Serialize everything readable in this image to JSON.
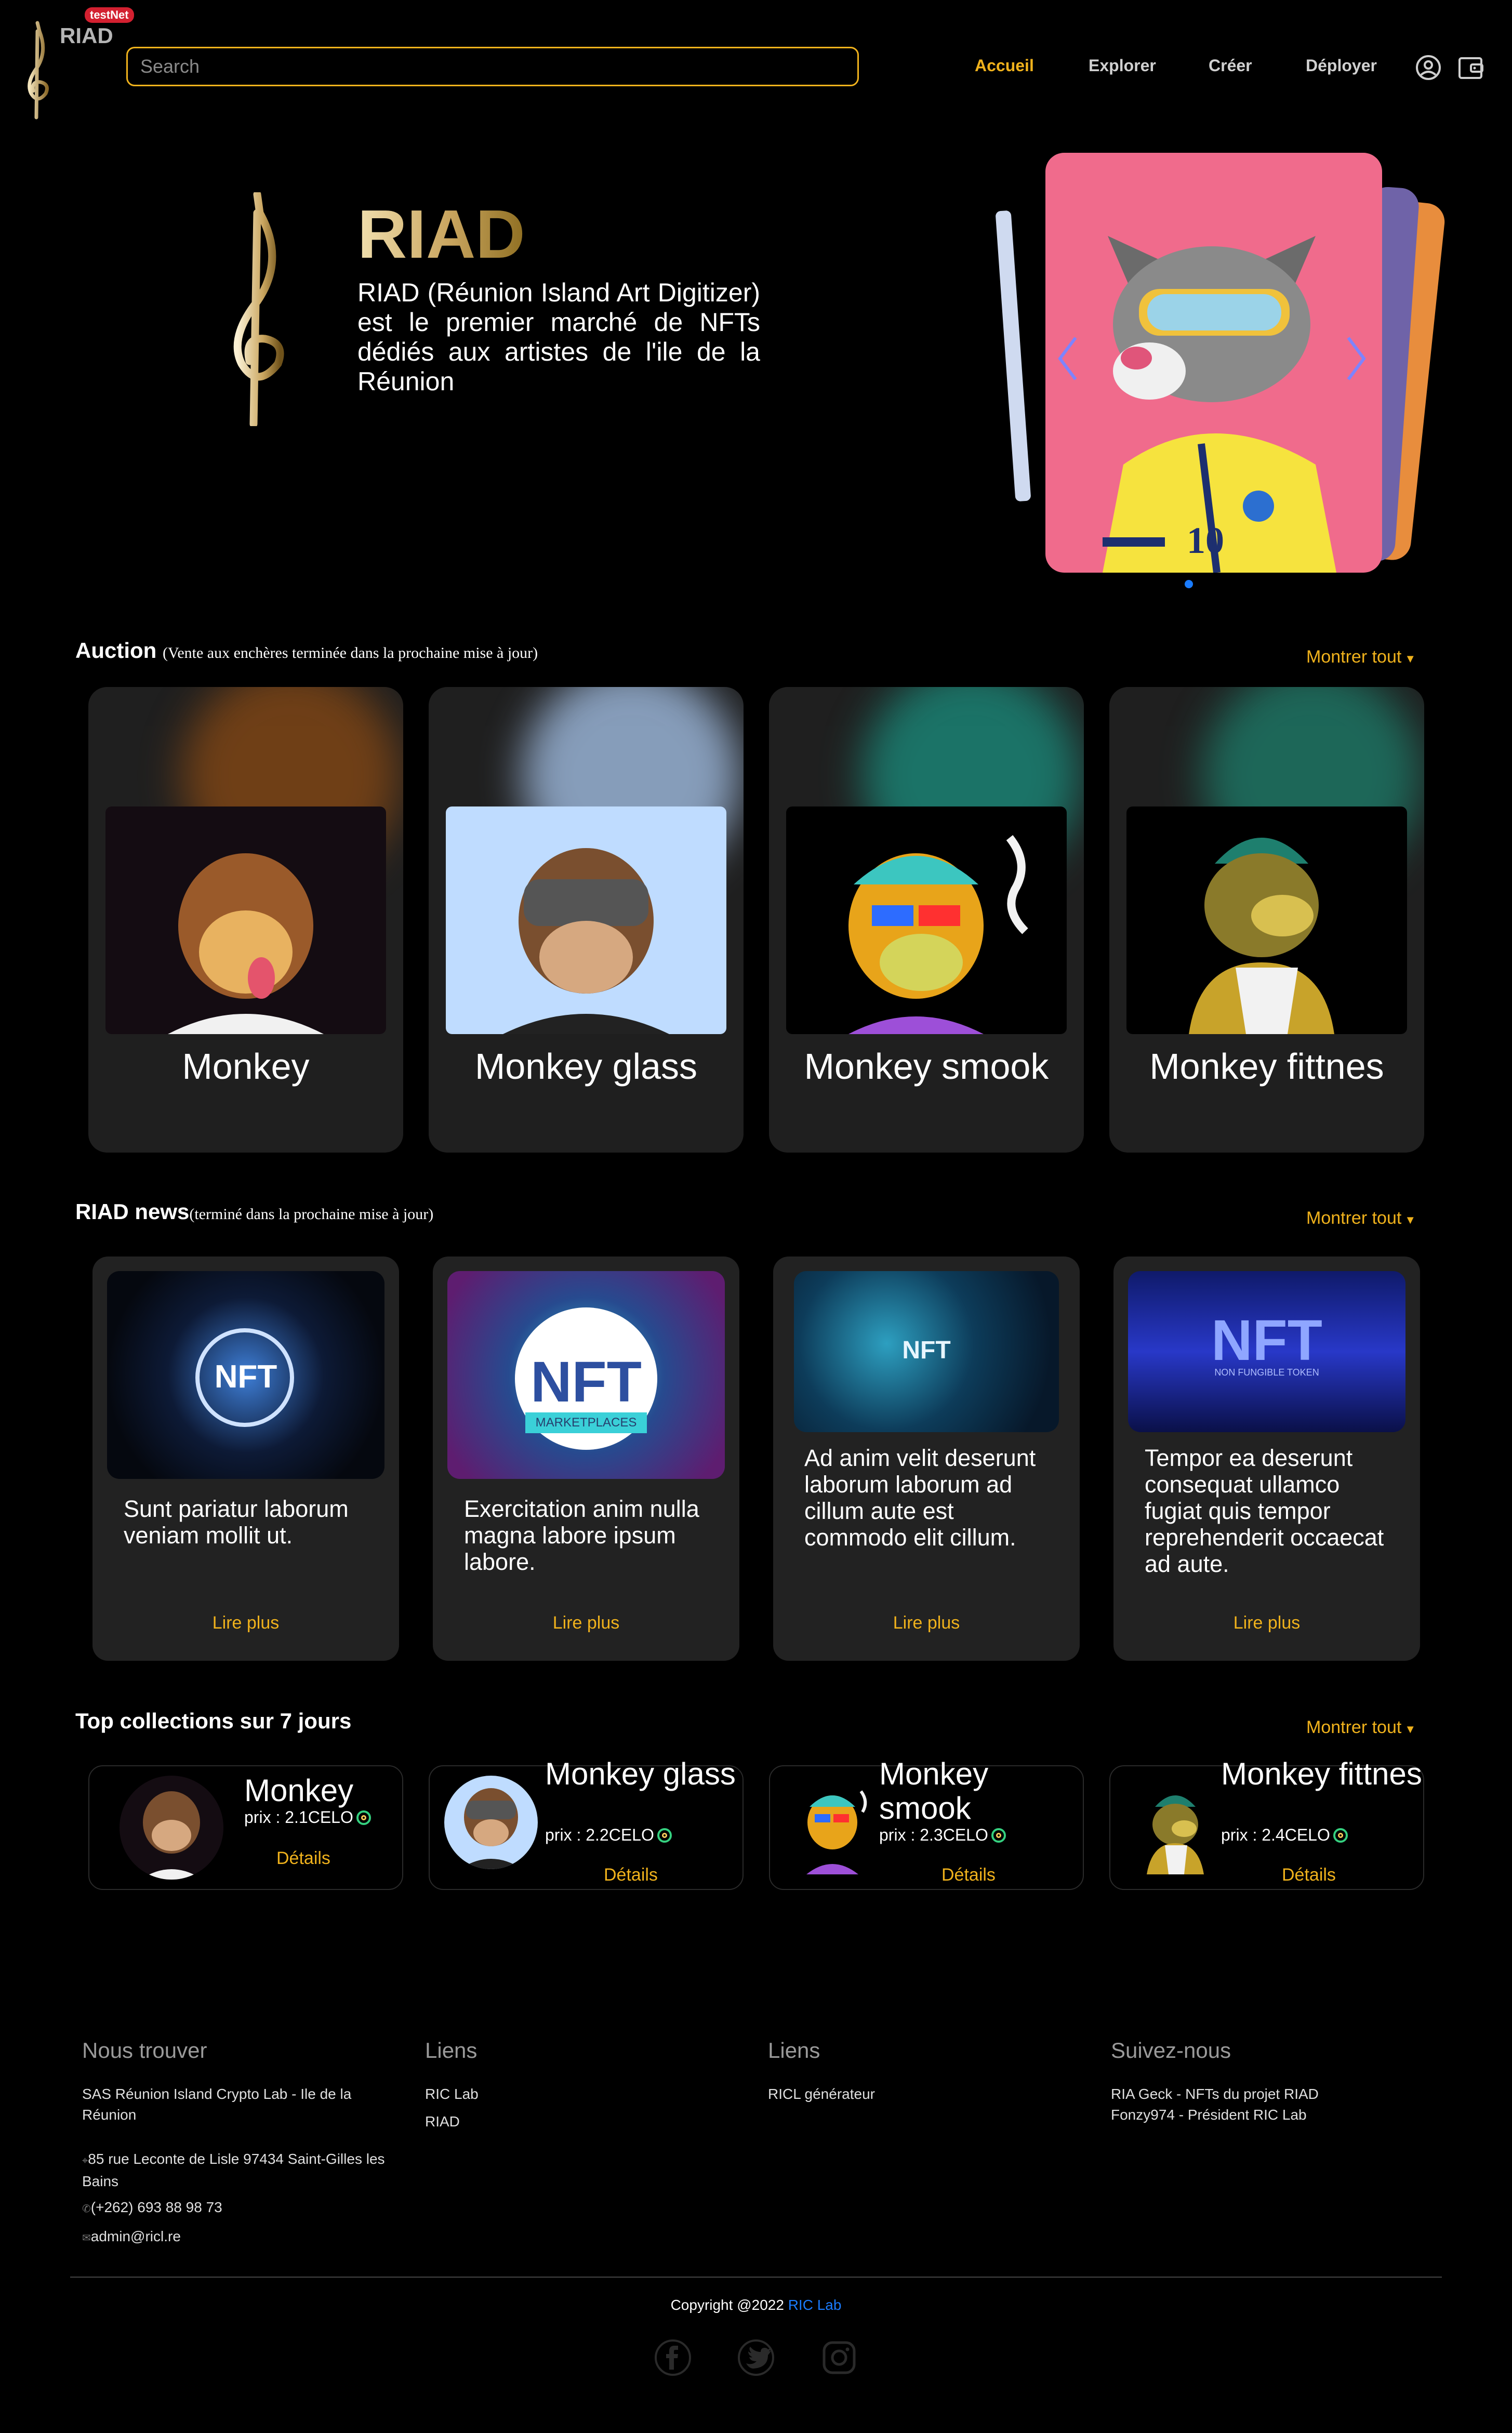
{
  "header": {
    "brand": "RIAD",
    "badge": "testNet",
    "search_placeholder": "Search",
    "nav": [
      "Accueil",
      "Explorer",
      "Créer",
      "Déployer"
    ],
    "active_nav": "Accueil",
    "icons": [
      "user-circle-icon",
      "wallet-icon"
    ]
  },
  "hero": {
    "title": "RIAD",
    "description": "RIAD (Réunion Island Art Digitizer) est le premier marché de NFTs dédiés aux artistes de l'ile de la Réunion",
    "carousel": {
      "active_index": 0,
      "dots": 1,
      "prev_icon": "chevron-left-icon",
      "next_icon": "chevron-right-icon"
    }
  },
  "auction": {
    "title": "Auction",
    "subtitle": "(Vente aux enchères terminée dans la prochaine mise à jour)",
    "show_all": "Montrer tout",
    "items": [
      {
        "name": "Monkey"
      },
      {
        "name": "Monkey glass"
      },
      {
        "name": "Monkey smook"
      },
      {
        "name": "Monkey fittnes"
      }
    ]
  },
  "news": {
    "title": "RIAD news",
    "subtitle": "(terminé dans la prochaine mise à jour)",
    "show_all": "Montrer tout",
    "items": [
      {
        "image_text": "NFT",
        "text": "Sunt pariatur laborum veniam mollit ut.",
        "more": "Lire plus"
      },
      {
        "image_text": "NFT",
        "image_caption": "MARKETPLACES",
        "text": "Exercitation anim nulla magna labore ipsum labore.",
        "more": "Lire plus"
      },
      {
        "image_text": "NFT",
        "text": "Ad anim velit deserunt laborum laborum ad cillum aute est commodo elit cillum.",
        "more": "Lire plus"
      },
      {
        "image_text": "NFT",
        "image_caption": "NON FUNGIBLE TOKEN",
        "text": "Tempor ea deserunt consequat ullamco fugiat quis tempor reprehenderit occaecat ad aute.",
        "more": "Lire plus"
      }
    ]
  },
  "collections": {
    "title": "Top collections sur 7 jours",
    "show_all": "Montrer tout",
    "items": [
      {
        "name": "Monkey",
        "price": "prix : 2.1CELO",
        "details": "Détails"
      },
      {
        "name": "Monkey glass",
        "price": "prix : 2.2CELO",
        "details": "Détails"
      },
      {
        "name": "Monkey smook",
        "price": "prix : 2.3CELO",
        "details": "Détails"
      },
      {
        "name": "Monkey fittnes",
        "price": "prix : 2.4CELO",
        "details": "Détails"
      }
    ]
  },
  "footer": {
    "col1": {
      "title": "Nous trouver",
      "company": "SAS Réunion Island Crypto Lab - Ile de la Réunion",
      "address": "85 rue Leconte de Lisle 97434 Saint-Gilles les Bains",
      "phone": "(+262) 693 88 98 73",
      "email": "admin@ricl.re"
    },
    "col2": {
      "title": "Liens",
      "links": [
        "RIC Lab",
        "RIAD"
      ]
    },
    "col3": {
      "title": "Liens",
      "links": [
        "RICL générateur"
      ]
    },
    "col4": {
      "title": "Suivez-nous",
      "links": [
        "RIA Geck - NFTs du projet RIAD",
        "Fonzy974 - Président RIC Lab"
      ]
    },
    "copyright_prefix": "Copyright @2022",
    "copyright_link": "RIC Lab",
    "social": [
      "facebook-icon",
      "twitter-icon",
      "instagram-icon"
    ]
  },
  "colors": {
    "accent": "#f0b21c",
    "background": "#000000",
    "card": "#1f1f1f",
    "link": "#1a7cff"
  }
}
